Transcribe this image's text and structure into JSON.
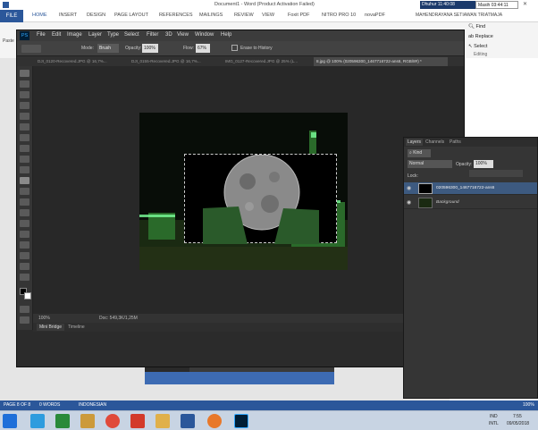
{
  "word": {
    "title": "Document1 - Word (Product Activation Failed)",
    "clock_left": "Dhuhur 11:40:08",
    "clock_right": "Masih 03:44:11",
    "user": "MAHENDRAYANA SETIAWAN TRIATMAJA",
    "tabs": [
      "FILE",
      "HOME",
      "INSERT",
      "DESIGN",
      "PAGE LAYOUT",
      "REFERENCES",
      "MAILINGS",
      "REVIEW",
      "VIEW",
      "Foxit PDF",
      "NITRO PRO 10",
      "novaPDF"
    ],
    "paste_label": "Paste",
    "editing": {
      "find": "Find",
      "replace": "Replace",
      "select": "Select",
      "group": "Editing"
    },
    "status": {
      "page": "PAGE 8 OF 8",
      "words": "0 WORDS",
      "lang": "INDONESIAN",
      "zoom": "100%"
    }
  },
  "ps": {
    "logo": "PS",
    "menu": [
      "File",
      "Edit",
      "Image",
      "Layer",
      "Type",
      "Select",
      "Filter",
      "3D",
      "View",
      "Window",
      "Help"
    ],
    "options": {
      "mode_label": "Mode:",
      "mode_value": "Brush",
      "opacity_label": "Opacity:",
      "opacity_value": "100%",
      "flow_label": "Flow:",
      "flow_value": "67%",
      "erase_history": "Erase to History"
    },
    "doc_tabs": [
      "DJI_0120-Recovered.JPG @ 16,7%...",
      "DJI_0155-Recovered.JPG @ 16,7%...",
      "IMG_0127-Recovered.JPG @ 25% (L...",
      "8.jpg @ 100% (020596300_1467716722-ans6, RGB/8#) *"
    ],
    "status": {
      "zoom": "100%",
      "doc": "Doc: 549,3K/1,25M"
    },
    "bottom_tabs": [
      "Mini Bridge",
      "Timeline"
    ]
  },
  "layers": {
    "tabs": [
      "Layers",
      "Channels",
      "Paths"
    ],
    "kind": "Kind",
    "blend": "Normal",
    "opacity_label": "Opacity:",
    "opacity_value": "100%",
    "lock_label": "Lock:",
    "fill_label": "Fill:",
    "items": [
      {
        "name": "020596300_1467716722-ans6"
      },
      {
        "name": "Background"
      }
    ]
  },
  "taskbar": {
    "lang": "IND",
    "lang2": "INTL",
    "time": "7:55",
    "date": "09/05/2018"
  },
  "colors": {
    "word_blue": "#2b579a",
    "ps_bg": "#2b2b2b",
    "selection": "#3d5a80"
  }
}
